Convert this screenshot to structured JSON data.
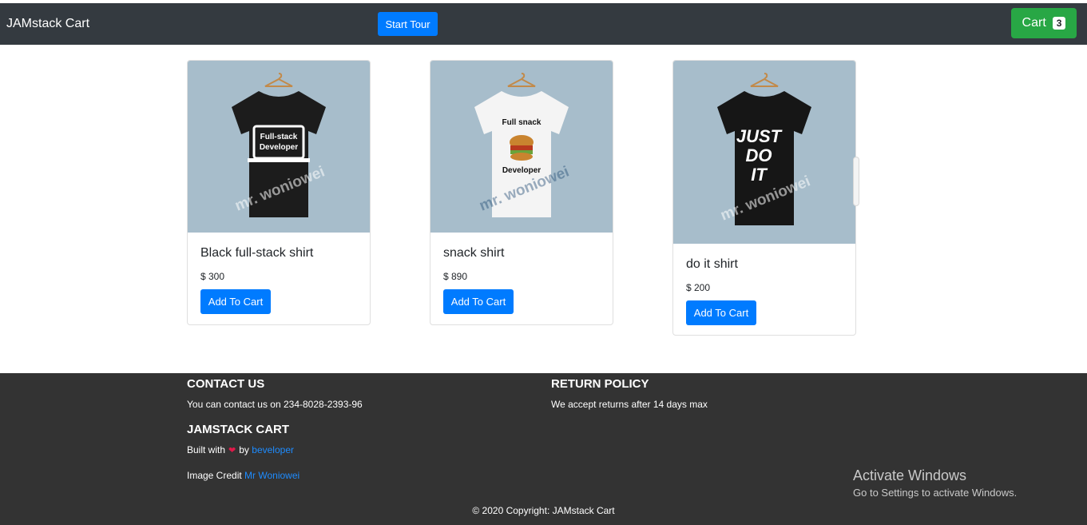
{
  "navbar": {
    "brand": "JAMstack Cart",
    "tour_label": "Start Tour",
    "cart_label": "Cart",
    "cart_count": "3"
  },
  "products": [
    {
      "title": "Black full-stack shirt",
      "price": "$ 300",
      "button": "Add To Cart",
      "shirt_color": "#1c1c1c",
      "print_lines": [
        "Full-stack",
        "Developer"
      ],
      "watermark": "mr. woniowei"
    },
    {
      "title": "snack shirt",
      "price": "$ 890",
      "button": "Add To Cart",
      "shirt_color": "#f4f4f4",
      "print_lines": [
        "Full snack",
        "Developer"
      ],
      "watermark": "mr. woniowei"
    },
    {
      "title": "do it shirt",
      "price": "$ 200",
      "button": "Add To Cart",
      "shirt_color": "#161616",
      "print_lines": [
        "JUST",
        "DO",
        "IT"
      ],
      "watermark": "mr. woniowei"
    }
  ],
  "footer": {
    "contact_heading": "CONTACT US",
    "contact_text": "You can contact us on 234-8028-2393-96",
    "return_heading": "RETURN POLICY",
    "return_text": "We accept returns after 14 days max",
    "cart_heading": "JAMSTACK CART",
    "built_prefix": "Built with",
    "built_by": "by",
    "built_link": "beveloper",
    "credit_prefix": "Image Credit",
    "credit_link": "Mr Woniowei",
    "copyright": "© 2020 Copyright: JAMstack Cart"
  },
  "overlay": {
    "activate_title": "Activate Windows",
    "activate_sub": "Go to Settings to activate Windows."
  },
  "colors": {
    "navbar": "#343a40",
    "primary": "#007bff",
    "success": "#28a745",
    "footer": "#333333",
    "image_bg": "#a7bdcb"
  }
}
